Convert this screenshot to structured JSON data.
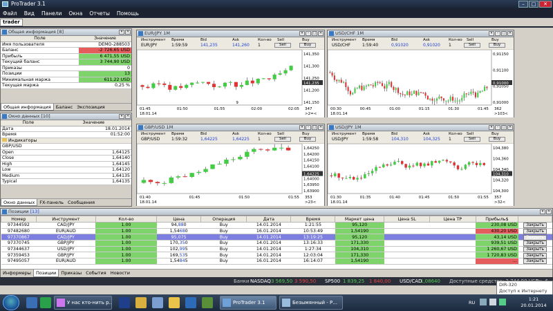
{
  "app": {
    "title": "ProTrader 3.1"
  },
  "menu": [
    "Файл",
    "Вид",
    "Панели",
    "Окна",
    "Отчеты",
    "Помощь"
  ],
  "workspace_tab": "trader",
  "colors": {
    "up": "#44cc44",
    "down": "#e03434",
    "blue": "#2040d0",
    "green_cell": "#7ed36a",
    "red_cell": "#e55c5c"
  },
  "general": {
    "title": "Общая информация",
    "badge": "[8]",
    "col_field": "Поле",
    "col_value": "Значение",
    "rows": [
      {
        "k": "Имя пользователя",
        "v": "DEMO-288503",
        "c": ""
      },
      {
        "k": "Баланс",
        "v": "-2 726,65 USD",
        "c": "red"
      },
      {
        "k": "Прибыль",
        "v": "6 471,55 USD",
        "c": "green"
      },
      {
        "k": "Текущий баланс",
        "v": "3 744,90 USD",
        "c": "green"
      },
      {
        "k": "Приказы",
        "v": "0",
        "c": ""
      },
      {
        "k": "Позиции",
        "v": "13",
        "c": "green"
      },
      {
        "k": "Минимальная маржа",
        "v": "611,22 USD",
        "c": "green"
      },
      {
        "k": "Текущая маржа",
        "v": "0,25 %",
        "c": ""
      }
    ],
    "tabs": [
      "Общая информация",
      "Баланс",
      "Экспозиция"
    ]
  },
  "datawin": {
    "title": "Окно данных",
    "badge": "[10]",
    "col_field": "Поле",
    "col_value": "Значение",
    "rows": [
      {
        "k": "Дата",
        "v": "18.01.2014"
      },
      {
        "k": "Время",
        "v": "01:52:00"
      }
    ],
    "group": "Индикаторы",
    "symbol": "GBP/USD",
    "ohlc": [
      {
        "k": "Open",
        "v": "1,64125"
      },
      {
        "k": "Close",
        "v": "1,64140"
      },
      {
        "k": "High",
        "v": "1,64145"
      },
      {
        "k": "Low",
        "v": "1,64120"
      },
      {
        "k": "Medium",
        "v": "1,64135"
      },
      {
        "k": "Typical",
        "v": "1,64135"
      }
    ],
    "tabs": [
      "Окно данных",
      "FX-панель",
      "Сообщения"
    ]
  },
  "chart_hdr": {
    "instrument": "Инструмент",
    "time": "Время",
    "bid": "Bid",
    "ask": "Ask",
    "qty": "Кол-во",
    "sell": "Sell",
    "buy": "Buy"
  },
  "chart_data": [
    {
      "type": "candlestick",
      "title": "EUR/JPY",
      "tf": "1M",
      "time": "1:59:59",
      "bid": "141,235",
      "ask": "141,260",
      "qty": "1",
      "yticks": [
        "141,350",
        "141,300",
        "141,250",
        "141,200",
        "141,150"
      ],
      "ylim": [
        141.13,
        141.38
      ],
      "xticks": [
        "01:45",
        "01:50",
        "01:55",
        "02:00",
        "02:05"
      ],
      "date": "18.01.14",
      "last": "141,235",
      "corner": "347",
      "corner2": ">2=<",
      "ind": "9",
      "seed": 3,
      "n": 28,
      "start": 141.22,
      "trend": 0.0
    },
    {
      "type": "candlestick",
      "title": "USD/CHF",
      "tf": "1M",
      "time": "1:59:40",
      "bid": "0,91020",
      "ask": "0,91020",
      "qty": "1",
      "yticks": [
        "0,91150",
        "0,91100",
        "0,91050",
        "0,91000"
      ],
      "ylim": [
        0.9097,
        0.9119
      ],
      "xticks": [
        "00:30",
        "00:45",
        "01:00",
        "01:15",
        "01:30",
        "01:45"
      ],
      "date": "18.01.14",
      "last": "0,91000",
      "corner": "362",
      "corner2": ">103<",
      "seed": 7,
      "n": 70,
      "start": 0.911,
      "trend": -1e-05
    },
    {
      "type": "candlestick",
      "title": "GBP/USD",
      "tf": "1M",
      "time": "1:59:32",
      "bid": "1,64225",
      "ask": "1,64225",
      "qty": "1",
      "yticks": [
        "1,64250",
        "1,64200",
        "1,64150",
        "1,64100",
        "1,64050",
        "1,64000",
        "1,63950",
        "1,63900"
      ],
      "ylim": [
        1.6385,
        1.6427
      ],
      "xticks": [
        "01:40",
        "01:45",
        "01:50",
        "01:55"
      ],
      "date": "18.01.14",
      "last": "1,64225",
      "corner": "353",
      "corner2": ">23<",
      "seed": 11,
      "n": 22,
      "start": 1.6394,
      "trend": 0.00013
    },
    {
      "type": "candlestick",
      "title": "USD/JPY",
      "tf": "1M",
      "time": "1:59:58",
      "bid": "104,310",
      "ask": "104,325",
      "qty": "1",
      "yticks": [
        "104,380",
        "104,360",
        "104,340",
        "104,320",
        "104,300"
      ],
      "ylim": [
        104.28,
        104.39
      ],
      "xticks": [
        "01:30",
        "01:35",
        "01:40",
        "01:45",
        "01:50",
        "01:55"
      ],
      "date": "18.01.14",
      "last": "104,310",
      "corner": "357",
      "corner2": ">32<",
      "seed": 5,
      "n": 42,
      "start": 104.32,
      "trend": 0.0
    }
  ],
  "positions": {
    "title": "Позиции",
    "badge": "[13]",
    "cols": [
      "Номер",
      "Инструмент",
      "Кол-во",
      "Цена",
      "Операция",
      "Дата",
      "Время",
      "Маркет цена",
      "Цена SL",
      "Цена TP",
      "Прибыль$",
      ""
    ],
    "rows": [
      {
        "n": "97344592",
        "i": "CAD/JPY",
        "q": "1.00",
        "p": "94,880",
        "o": "Buy",
        "d": "14.01.2014",
        "t": "1:21:55",
        "m": "95,120",
        "pr": "230,08 USD",
        "prc": "green",
        "sel": false
      },
      {
        "n": "97482680",
        "i": "EUR/AUD",
        "q": "1.00",
        "p": "1,54680",
        "o": "Buy",
        "d": "16.01.2014",
        "t": "10:53:49",
        "m": "1,54190",
        "pr": "430,20 USD",
        "prc": "red",
        "sel": false
      },
      {
        "n": "97370867",
        "i": "CAD/JPY",
        "q": "1.00",
        "p": "95,075",
        "o": "Buy",
        "d": "14.01.2014",
        "t": "13:19:25",
        "m": "95,120",
        "pr": "43,14 USD",
        "prc": "green",
        "sel": true
      },
      {
        "n": "97370745",
        "i": "GBP/JPY",
        "q": "1.00",
        "p": "170,350",
        "o": "Buy",
        "d": "14.01.2014",
        "t": "13:16:33",
        "m": "171,330",
        "pr": "939,51 USD",
        "prc": "green",
        "sel": false
      },
      {
        "n": "97344637",
        "i": "USD/JPY",
        "q": "1.00",
        "p": "102,995",
        "o": "Buy",
        "d": "14.01.2014",
        "t": "1:27:34",
        "m": "104,310",
        "pr": "1 260,67 USD",
        "prc": "green",
        "sel": false
      },
      {
        "n": "97359453",
        "i": "GBP/JPY",
        "q": "1.00",
        "p": "169,535",
        "o": "Buy",
        "d": "14.01.2014",
        "t": "12:03:04",
        "m": "171,330",
        "pr": "1 720,83 USD",
        "prc": "green",
        "sel": false
      },
      {
        "n": "97495057",
        "i": "EUR/AUD",
        "q": "1.00",
        "p": "1,54845",
        "o": "Buy",
        "d": "16.01.2014",
        "t": "16:14:07",
        "m": "1,54190",
        "pr": "...",
        "prc": "red",
        "sel": false
      }
    ],
    "close_label": "Закрыть"
  },
  "bottom_tabs": [
    "Информеры",
    "Позиции",
    "Приказы",
    "События",
    "Новости"
  ],
  "status": {
    "banks": "Банки",
    "ticker1": "NASDAQ",
    "t1a": "3 569,50",
    "t1b": "3 590,50",
    "ticker2": "SP500",
    "t2a": "1 839,25",
    "t2b": "1 840,00",
    "ticker3": "USD/CAD",
    "t3a": "1,08640",
    "right": "Доступные средства: 3 744,90 USD",
    "extra": "Ак. 6"
  },
  "tooltip": {
    "line1": "DIR-320",
    "line2": "Доступ к Интернету"
  },
  "taskbar": {
    "btn1": "У нас кто-нить р...",
    "btn2": "ProTrader 3.1",
    "btn3": "Безымянный - Р...",
    "lang": "RU",
    "time": "1:21",
    "date": "20.01.2014"
  }
}
